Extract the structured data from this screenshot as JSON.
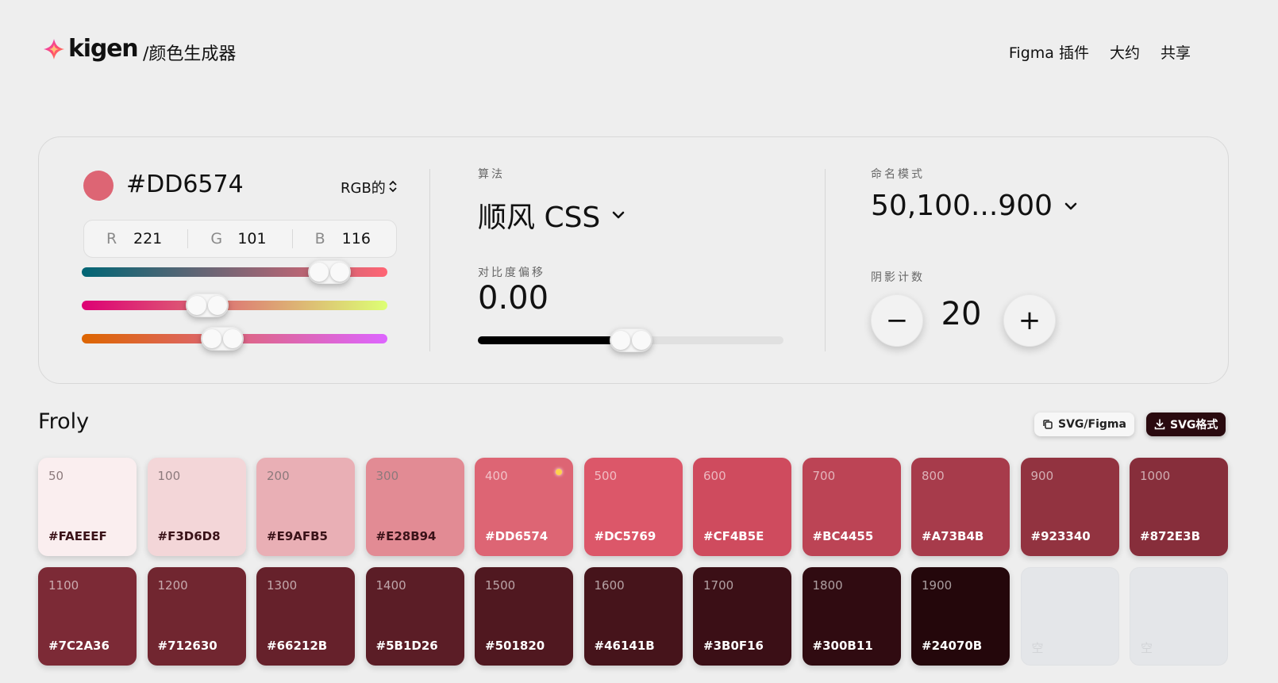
{
  "header": {
    "logo_text": "kigen",
    "page_title": "/颜色生成器",
    "nav": [
      "Figma 插件",
      "大约",
      "共享"
    ]
  },
  "color_input": {
    "hex": "#DD6574",
    "mode": "RGB的",
    "channels": [
      {
        "letter": "R",
        "value": "221"
      },
      {
        "letter": "G",
        "value": "101"
      },
      {
        "letter": "B",
        "value": "116"
      }
    ],
    "slider_levels": [
      0.81,
      0.41,
      0.46
    ]
  },
  "algorithm": {
    "label": "算法",
    "value": "顺风 CSS",
    "contrast_label": "对比度偏移",
    "contrast_value": "0.00",
    "contrast_level": 0.5
  },
  "naming": {
    "label": "命名模式",
    "value": "50,100...900",
    "shade_count_label": "阴影计数",
    "shade_count": "20",
    "minus": "−",
    "plus": "+"
  },
  "palette": {
    "name": "Froly",
    "copy_button": "SVG/Figma",
    "download_button": "SVG格式",
    "base_shade": "400",
    "shades": [
      {
        "shade": "50",
        "hex": "#FAEEEF"
      },
      {
        "shade": "100",
        "hex": "#F3D6D8"
      },
      {
        "shade": "200",
        "hex": "#E9AFB5"
      },
      {
        "shade": "300",
        "hex": "#E28B94"
      },
      {
        "shade": "400",
        "hex": "#DD6574"
      },
      {
        "shade": "500",
        "hex": "#DC5769"
      },
      {
        "shade": "600",
        "hex": "#CF4B5E"
      },
      {
        "shade": "700",
        "hex": "#BC4455"
      },
      {
        "shade": "800",
        "hex": "#A73B4B"
      },
      {
        "shade": "900",
        "hex": "#923340"
      },
      {
        "shade": "1000",
        "hex": "#872E3B"
      },
      {
        "shade": "1100",
        "hex": "#7C2A36"
      },
      {
        "shade": "1200",
        "hex": "#712630"
      },
      {
        "shade": "1300",
        "hex": "#66212B"
      },
      {
        "shade": "1400",
        "hex": "#5B1D26"
      },
      {
        "shade": "1500",
        "hex": "#501820"
      },
      {
        "shade": "1600",
        "hex": "#46141B"
      },
      {
        "shade": "1700",
        "hex": "#3B0F16"
      },
      {
        "shade": "1800",
        "hex": "#300B11"
      },
      {
        "shade": "1900",
        "hex": "#24070B"
      }
    ],
    "empty_label": "空",
    "empty_count": 2
  },
  "colors": {
    "accent": "#DD6574",
    "page_bg": "#EEEEEE",
    "dark_button": "#2A0A0F"
  },
  "icons": [
    "logo-icon",
    "sort-arrows-icon",
    "chevron-down-icon",
    "copy-icon",
    "download-icon"
  ]
}
